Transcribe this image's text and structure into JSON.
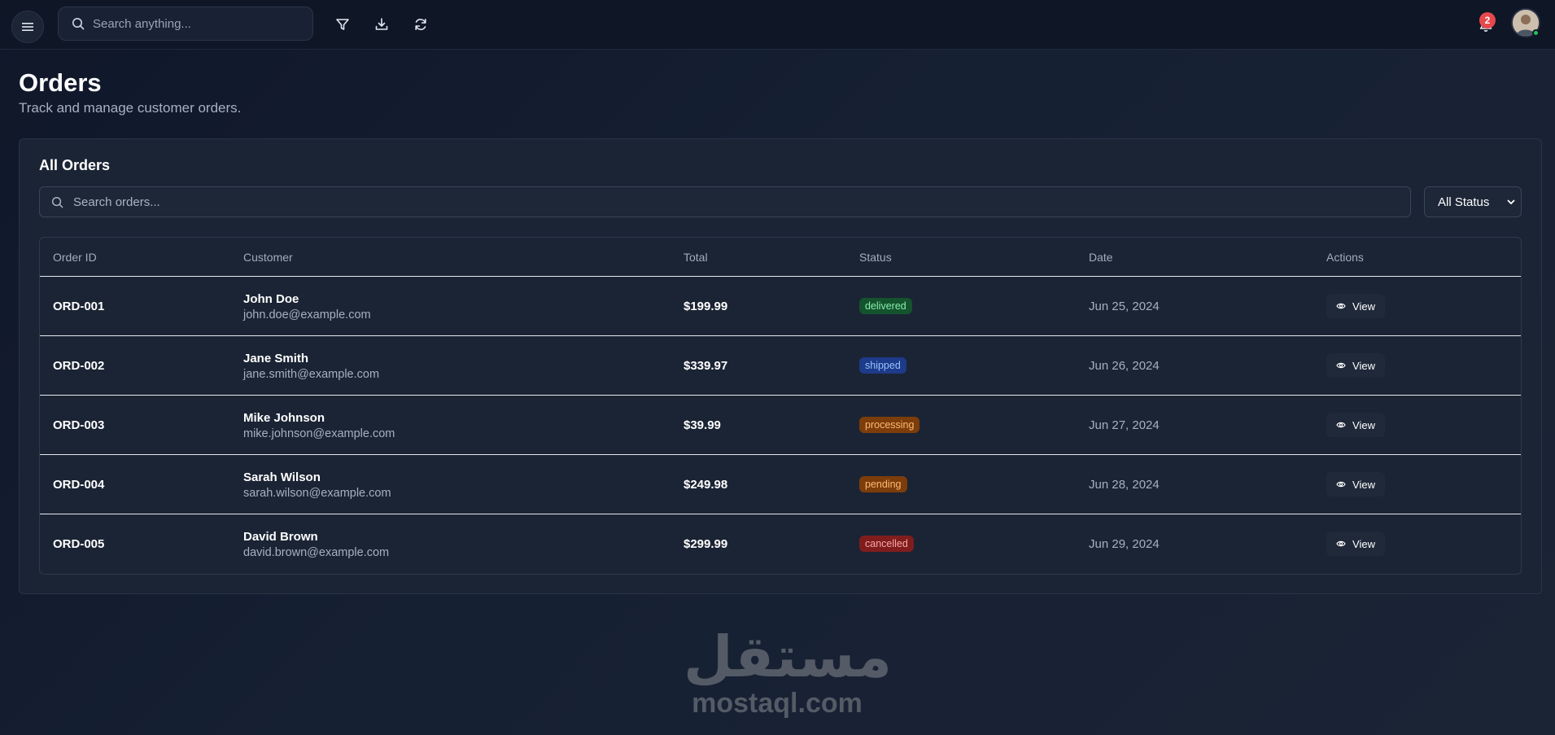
{
  "header": {
    "search_placeholder": "Search anything...",
    "notification_count": "2",
    "icons": [
      "menu-icon",
      "search-icon",
      "filter-icon",
      "download-icon",
      "refresh-icon",
      "bell-icon",
      "avatar"
    ]
  },
  "page": {
    "title": "Orders",
    "subtitle": "Track and manage customer orders."
  },
  "card": {
    "title": "All Orders",
    "search_placeholder": "Search orders...",
    "status_filter": "All Status"
  },
  "table": {
    "columns": [
      "Order ID",
      "Customer",
      "Total",
      "Status",
      "Date",
      "Actions"
    ],
    "rows": [
      {
        "id": "ORD-001",
        "name": "John Doe",
        "email": "john.doe@example.com",
        "total": "$199.99",
        "status": "delivered",
        "date": "Jun 25, 2024",
        "action": "View"
      },
      {
        "id": "ORD-002",
        "name": "Jane Smith",
        "email": "jane.smith@example.com",
        "total": "$339.97",
        "status": "shipped",
        "date": "Jun 26, 2024",
        "action": "View"
      },
      {
        "id": "ORD-003",
        "name": "Mike Johnson",
        "email": "mike.johnson@example.com",
        "total": "$39.99",
        "status": "processing",
        "date": "Jun 27, 2024",
        "action": "View"
      },
      {
        "id": "ORD-004",
        "name": "Sarah Wilson",
        "email": "sarah.wilson@example.com",
        "total": "$249.98",
        "status": "pending",
        "date": "Jun 28, 2024",
        "action": "View"
      },
      {
        "id": "ORD-005",
        "name": "David Brown",
        "email": "david.brown@example.com",
        "total": "$299.99",
        "status": "cancelled",
        "date": "Jun 29, 2024",
        "action": "View"
      }
    ]
  },
  "status_colors": {
    "delivered": {
      "bg": "#14532d",
      "fg": "#86efac"
    },
    "shipped": {
      "bg": "#1e3a8a",
      "fg": "#93c5fd"
    },
    "processing": {
      "bg": "#7c3d0a",
      "fg": "#fdba74"
    },
    "pending": {
      "bg": "#7c3d0a",
      "fg": "#fdba74"
    },
    "cancelled": {
      "bg": "#7f1d1d",
      "fg": "#fca5a5"
    }
  },
  "watermark": {
    "arabic": "مستقل",
    "latin": "mostaql.com"
  }
}
